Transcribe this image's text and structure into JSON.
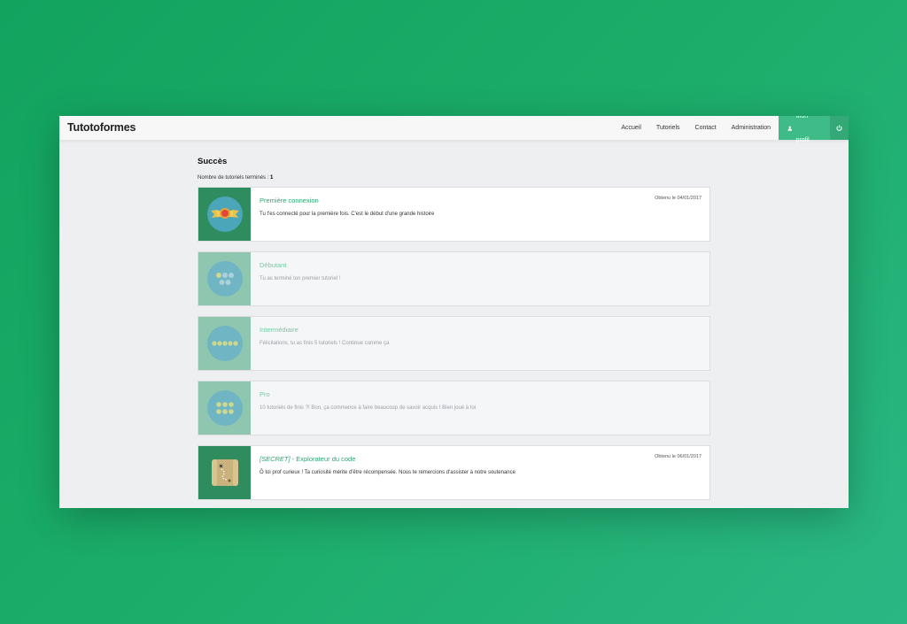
{
  "navbar": {
    "brand": "Tutotoformes",
    "links": [
      "Accueil",
      "Tutoriels",
      "Contact",
      "Administration"
    ],
    "profile_label": "Mon profil",
    "profile_icon": "user-icon",
    "power_icon": "power-icon"
  },
  "page": {
    "title": "Succès",
    "count_label": "Nombre de tutoriels terminés :",
    "count_value": "1"
  },
  "achievements": [
    {
      "title": "Première connexion",
      "description": "Tu t'es connecté pour la première fois. C'est le début d'une grande histoire",
      "date": "Obtenu le 04/01/2017",
      "unlocked": true,
      "icon": "ribbon-medal-icon"
    },
    {
      "title": "Débutant",
      "description": "Tu as terminé ton premier tutoriel !",
      "date": "",
      "unlocked": false,
      "icon": "three-stars-icon"
    },
    {
      "title": "Intermédiaire",
      "description": "Félicitations, tu as finis 5 tutoriels ! Continue comme ça",
      "date": "",
      "unlocked": false,
      "icon": "five-stars-icon"
    },
    {
      "title": "Pro",
      "description": "10 tutoriels de finis ?! Bon, ça commence à faire beaucoup de savoir acquis ! Bien joué à toi",
      "date": "",
      "unlocked": false,
      "icon": "six-stars-icon"
    },
    {
      "title_secret": "[SECRET]",
      "title": " - Explorateur du code",
      "description": "Ô toi prof curieux ! Ta curiosité mérite d'être récompensée. Nous te remercions d'assister à notre soutenance",
      "date": "Obtenu le 06/01/2017",
      "unlocked": true,
      "icon": "treasure-map-icon"
    }
  ],
  "colors": {
    "accent": "#2aa872",
    "profile_bg": "#3ebb86",
    "background": "#1cad6a"
  }
}
